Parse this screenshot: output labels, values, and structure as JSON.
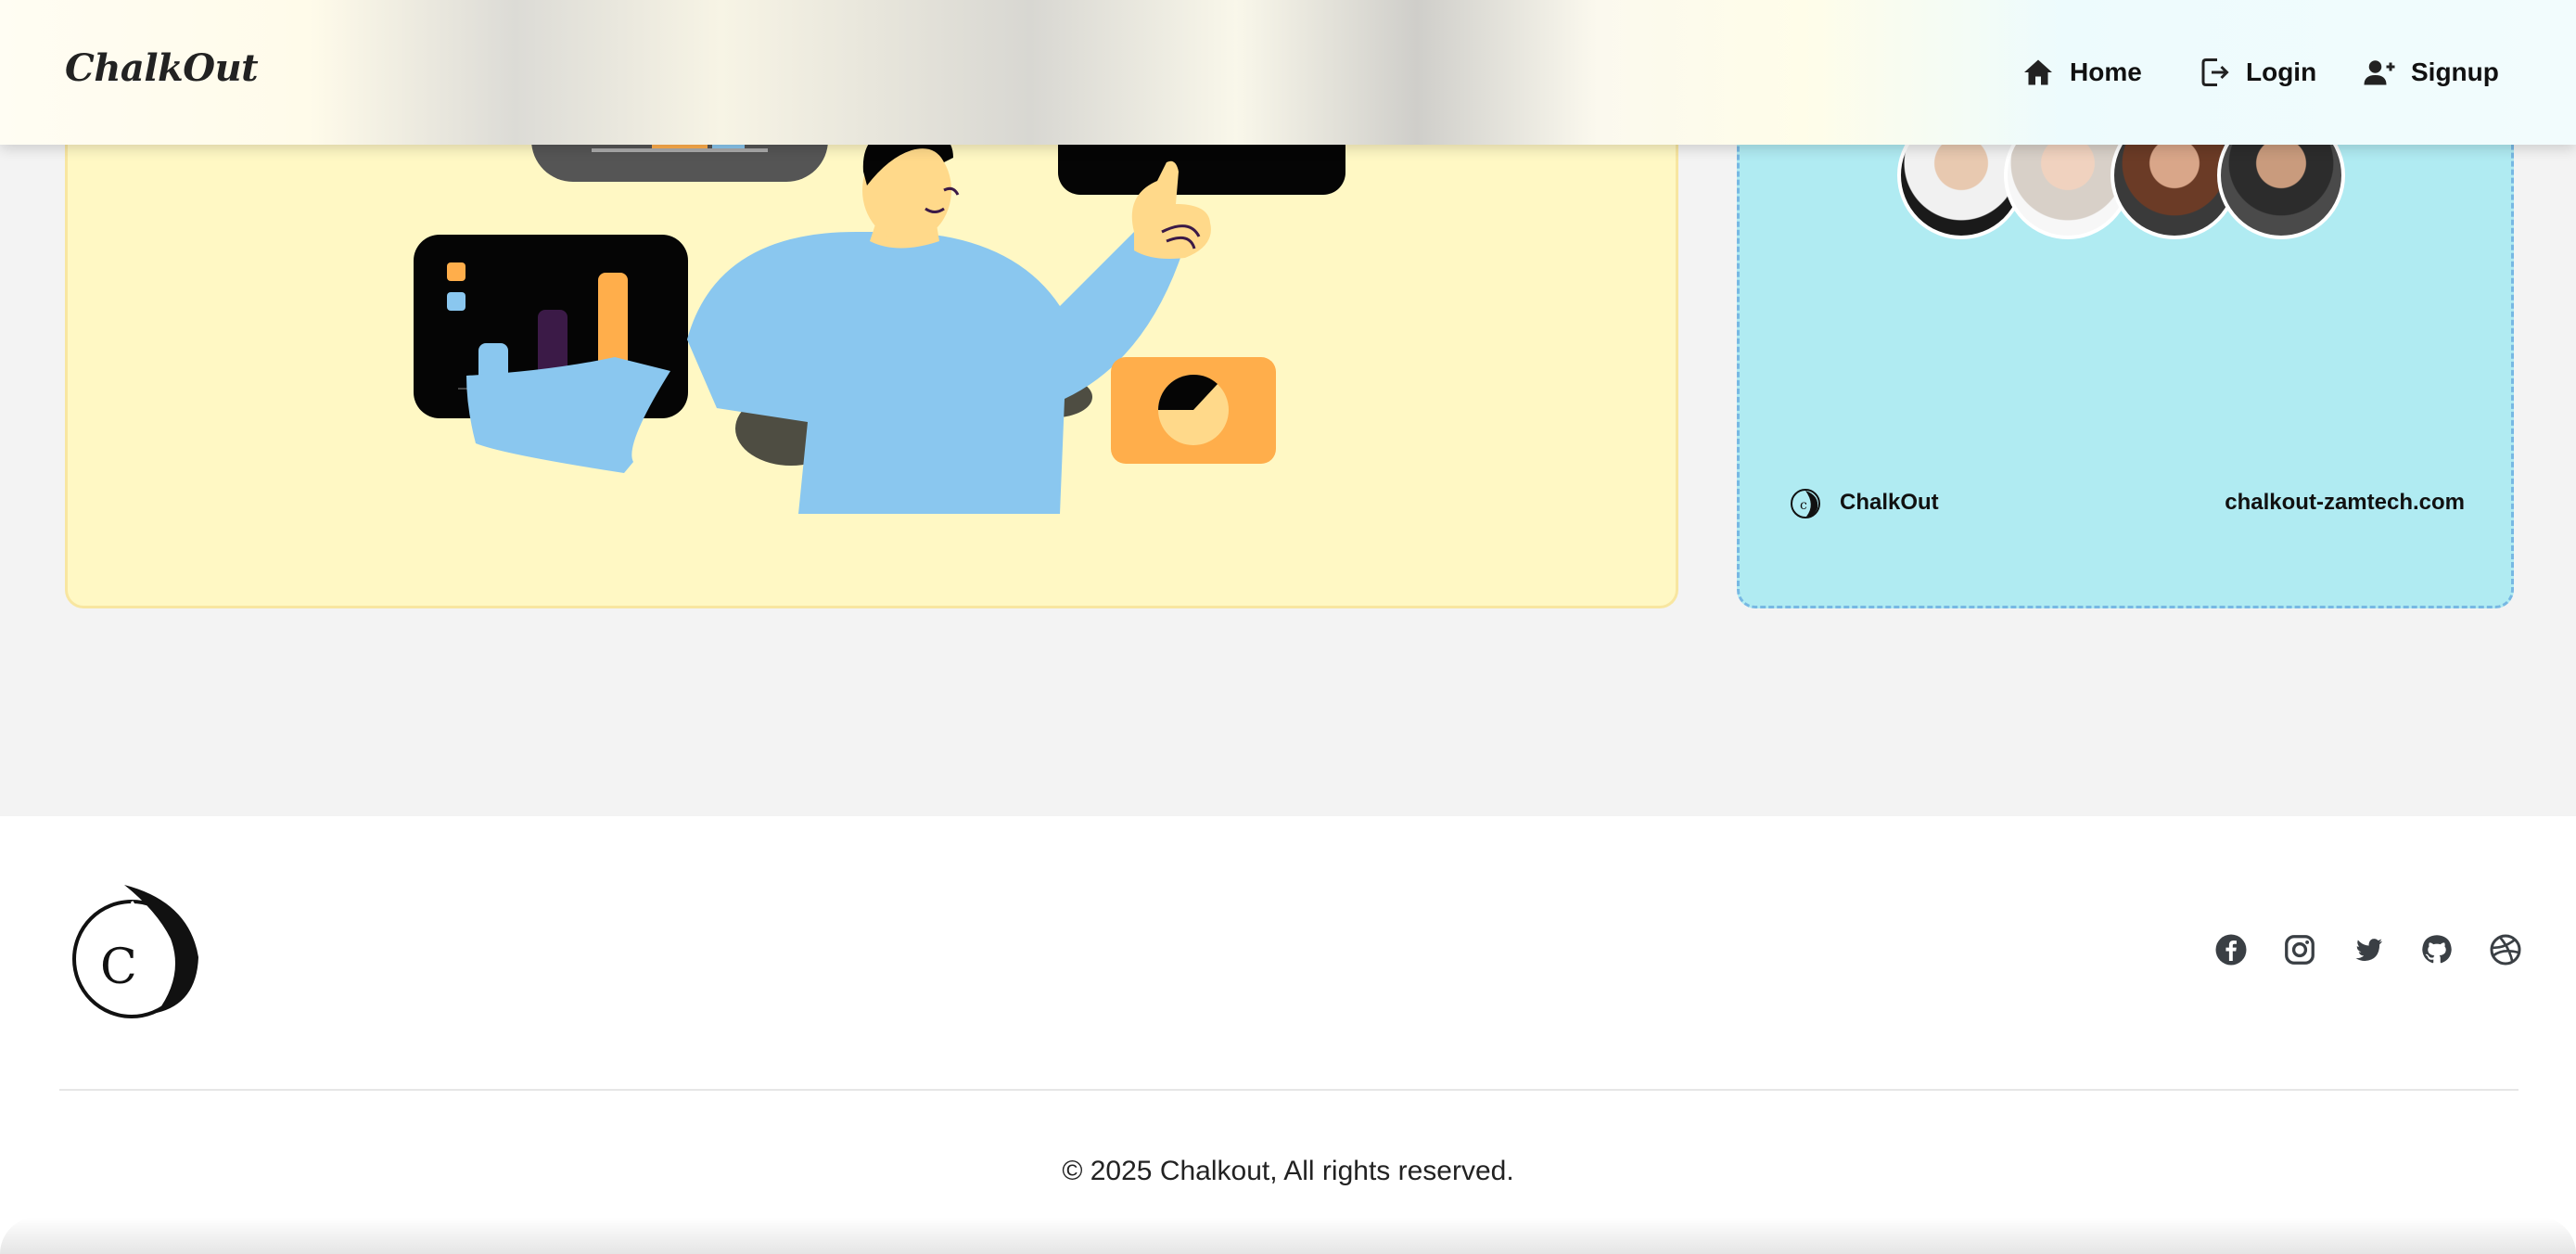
{
  "header": {
    "brand": "ChalkOut",
    "nav": {
      "home": "Home",
      "login": "Login",
      "signup": "Signup"
    }
  },
  "cyan_card": {
    "brand": "ChalkOut",
    "url": "chalkout-zamtech.com"
  },
  "footer": {
    "logo_letter": "C",
    "social_icons": [
      "facebook-icon",
      "instagram-icon",
      "twitter-icon",
      "github-icon",
      "dribbble-icon"
    ],
    "copyright": "© 2025 Chalkout, All rights reserved."
  },
  "colors": {
    "page_bg": "#f3f3f3",
    "yellow_card": "#fff8c4",
    "cyan_card": "#b0ebf2",
    "illustration_blue": "#8ac7ef",
    "illustration_orange": "#ffae4b",
    "illustration_purple": "#3b1a47"
  }
}
